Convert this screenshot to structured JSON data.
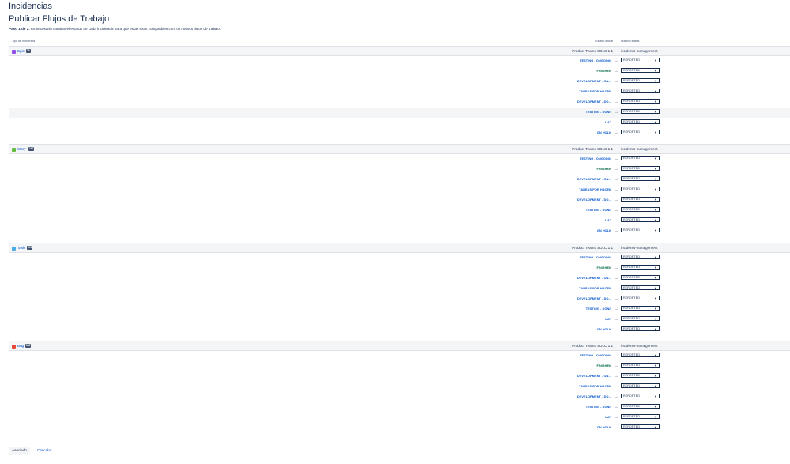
{
  "page": {
    "title": "Incidencias",
    "subtitle": "Publicar Flujos de Trabajo",
    "step_bold": "Paso 1 de 2:",
    "step_text": " Es necesario cambiar el estatus de cada incidencia para que estas sean compatibles con los nuevos flujos de trabajo."
  },
  "columns": {
    "type": "Tipo de Incidencia",
    "current": "Estado actual",
    "new": "Nuevo Estatus"
  },
  "workflows": {
    "old": "Product Teams SDLC 1.1",
    "new": "incidents-management"
  },
  "arrow": "→",
  "chevron": "▼",
  "colors": {
    "status_blue": "#0052cc",
    "status_green": "#006644",
    "epic": "#904ee2",
    "story": "#63ba3c",
    "task": "#4bade8",
    "bug": "#e5493a"
  },
  "sections": [
    {
      "type": "Epic",
      "icon": "epic-icon",
      "count": "78",
      "rows": [
        {
          "status": "TESTING - ONGOING",
          "color": "blue",
          "value": "REPORTED"
        },
        {
          "status": "FINISHED",
          "color": "green",
          "value": "REPORTED"
        },
        {
          "status": "DEVELOPMENT - ON...",
          "color": "blue",
          "value": "REPORTED"
        },
        {
          "status": "TAREAS POR HACER",
          "color": "blue",
          "value": "REPORTED"
        },
        {
          "status": "DEVELOPMENT - DO...",
          "color": "blue",
          "value": "REPORTED"
        },
        {
          "status": "TESTING - DONE",
          "color": "blue",
          "value": "REPORTED"
        },
        {
          "status": "UAT",
          "color": "blue",
          "value": "REPORTED"
        },
        {
          "status": "ON HOLD",
          "color": "blue",
          "value": "REPORTED"
        }
      ]
    },
    {
      "type": "Story",
      "icon": "story-icon",
      "count": "197",
      "rows": [
        {
          "status": "TESTING - ONGOING",
          "color": "blue",
          "value": "REPORTED"
        },
        {
          "status": "FINISHED",
          "color": "green",
          "value": "REPORTED"
        },
        {
          "status": "DEVELOPMENT - ON...",
          "color": "blue",
          "value": "REPORTED"
        },
        {
          "status": "TAREAS POR HACER",
          "color": "blue",
          "value": "REPORTED"
        },
        {
          "status": "DEVELOPMENT - DO...",
          "color": "blue",
          "value": "REPORTED"
        },
        {
          "status": "TESTING - DONE",
          "color": "blue",
          "value": "REPORTED"
        },
        {
          "status": "UAT",
          "color": "blue",
          "value": "REPORTED"
        },
        {
          "status": "ON HOLD",
          "color": "blue",
          "value": "REPORTED"
        }
      ]
    },
    {
      "type": "Task",
      "icon": "task-icon",
      "count": "376",
      "rows": [
        {
          "status": "TESTING - ONGOING",
          "color": "blue",
          "value": "REPORTED"
        },
        {
          "status": "FINISHED",
          "color": "green",
          "value": "REPORTED"
        },
        {
          "status": "DEVELOPMENT - ON...",
          "color": "blue",
          "value": "REPORTED"
        },
        {
          "status": "TAREAS POR HACER",
          "color": "blue",
          "value": "REPORTED"
        },
        {
          "status": "DEVELOPMENT - DO...",
          "color": "blue",
          "value": "REPORTED"
        },
        {
          "status": "TESTING - DONE",
          "color": "blue",
          "value": "REPORTED"
        },
        {
          "status": "UAT",
          "color": "blue",
          "value": "REPORTED"
        },
        {
          "status": "ON HOLD",
          "color": "blue",
          "value": "REPORTED"
        }
      ]
    },
    {
      "type": "Bug",
      "icon": "bug-icon",
      "count": "546",
      "rows": [
        {
          "status": "TESTING - ONGOING",
          "color": "blue",
          "value": "REPORTED"
        },
        {
          "status": "FINISHED",
          "color": "green",
          "value": "REPORTED"
        },
        {
          "status": "DEVELOPMENT - ON...",
          "color": "blue",
          "value": "REPORTED"
        },
        {
          "status": "TAREAS POR HACER",
          "color": "blue",
          "value": "REPORTED"
        },
        {
          "status": "DEVELOPMENT - DO...",
          "color": "blue",
          "value": "REPORTED"
        },
        {
          "status": "TESTING - DONE",
          "color": "blue",
          "value": "REPORTED"
        },
        {
          "status": "UAT",
          "color": "blue",
          "value": "REPORTED"
        },
        {
          "status": "ON HOLD",
          "color": "blue",
          "value": "REPORTED"
        }
      ]
    }
  ],
  "buttons": {
    "associate": "Asociado",
    "cancel": "Cancelar"
  }
}
